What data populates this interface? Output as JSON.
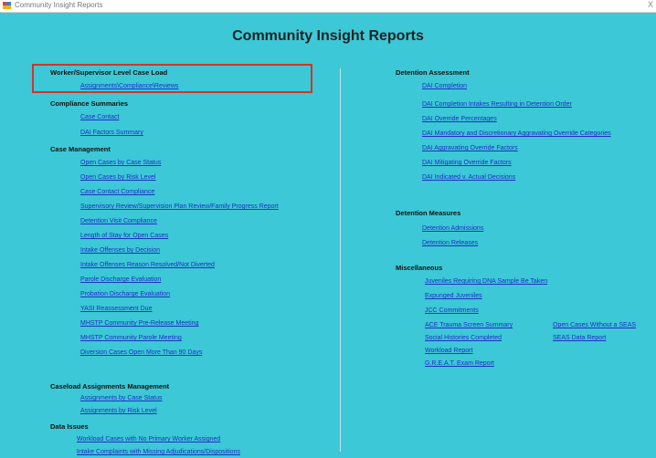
{
  "window": {
    "title": "Community Insight Reports",
    "close_label": "X"
  },
  "page_title": "Community Insight Reports",
  "left": {
    "worker": {
      "heading": "Worker/Supervisor Level Case Load",
      "links": [
        "Assignments\\Compliance\\Reviews"
      ]
    },
    "compliance": {
      "heading": "Compliance Summaries",
      "links": [
        "Case Contact",
        "DAI Factors Summary"
      ]
    },
    "case_mgmt": {
      "heading": "Case Management",
      "links": [
        "Open Cases by Case Status",
        "Open Cases by Risk Level",
        "Case Contact Compliance",
        "Supervisory Review/Supervision Plan Review/Family Progress Report",
        "Detention Visit Compliance",
        "Length of Stay for Open Cases",
        "Intake Offenses by Decision",
        "Intake Offenses Reason Resolved/Not Diverted",
        "Parole Discharge Evaluation",
        "Probation Discharge Evaluation",
        "YASI Reassessment Due",
        "MHSTP Community Pre-Release Meeting",
        "MHSTP Community Parole Meeting",
        "Diversion Cases Open More Than 90 Days"
      ]
    },
    "caseload": {
      "heading": "Caseload Assignments Management",
      "links": [
        "Assignments by Case Status",
        "Assignments by Risk Level"
      ]
    },
    "data_issues": {
      "heading": "Data Issues",
      "links": [
        "Workload Cases with No Primary Worker Assigned",
        "Intake Complaints with Missing Adjudications/Dispositions"
      ]
    }
  },
  "right": {
    "dai": {
      "heading": "Detention Assessment",
      "links": [
        "DAI Completion",
        "DAI Completion Intakes Resulting in Detention Order",
        "DAI Override Percentages",
        "DAI Mandatory and Discretionary Aggravating Override Categories",
        "DAI Aggravating Override Factors",
        "DAI Mitigating Override Factors",
        "DAI Indicated v. Actual Decisions"
      ]
    },
    "measures": {
      "heading": "Detention Measures",
      "links": [
        "Detention Admissions",
        "Detention Releases"
      ]
    },
    "misc": {
      "heading": "Miscellaneous",
      "links": [
        "Juveniles Requiring DNA Sample Be Taken",
        "Expunged Juveniles",
        "JCC Commitments",
        "ACE Trauma Screen Summary",
        "Social Histories Completed",
        "Workload Report",
        "G.R.E.A.T. Exam Report"
      ],
      "links_col2": [
        "Open Cases Without a SEAS",
        "SEAS Data Report"
      ]
    }
  },
  "colors": {
    "background": "#3cc8d6",
    "link": "#1f2fc4",
    "highlight": "#d6322d"
  }
}
